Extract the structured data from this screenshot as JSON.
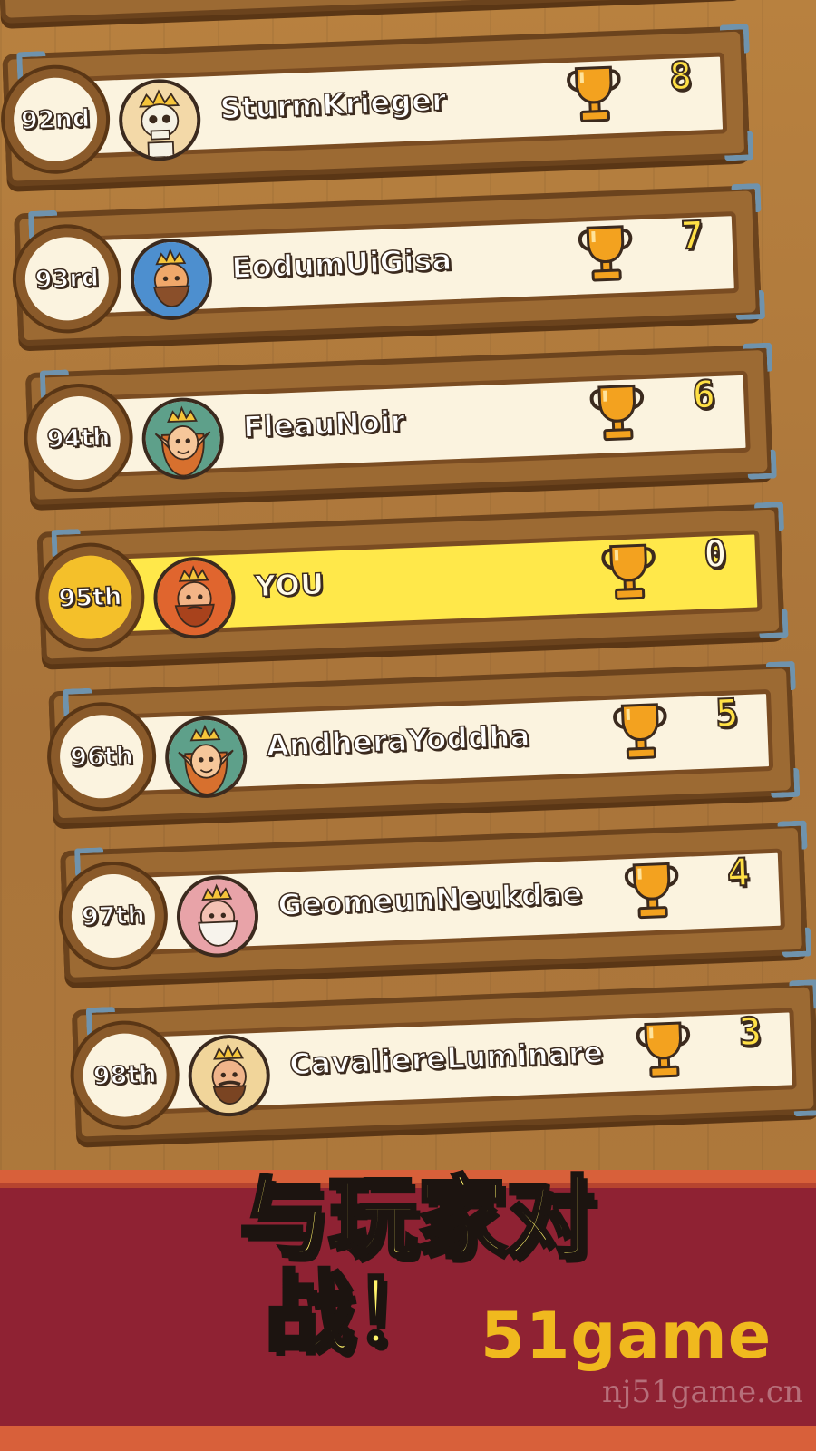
{
  "leaderboard": {
    "rows": [
      {
        "rank": "92nd",
        "name": "SturmKrieger",
        "score": "8",
        "avatar_icon": "skeleton-king-icon",
        "is_you": false
      },
      {
        "rank": "93rd",
        "name": "EodumUiGisa",
        "score": "7",
        "avatar_icon": "bearded-king-icon",
        "is_you": false
      },
      {
        "rank": "94th",
        "name": "FleauNoir",
        "score": "6",
        "avatar_icon": "elf-queen-icon",
        "is_you": false
      },
      {
        "rank": "95th",
        "name": "YOU",
        "score": "0",
        "avatar_icon": "red-beard-king-icon",
        "is_you": true
      },
      {
        "rank": "96th",
        "name": "AndheraYoddha",
        "score": "5",
        "avatar_icon": "elf-queen-icon",
        "is_you": false
      },
      {
        "rank": "97th",
        "name": "GeomeunNeukdae",
        "score": "4",
        "avatar_icon": "old-white-beard-king-icon",
        "is_you": false
      },
      {
        "rank": "98th",
        "name": "CavaliereLuminare",
        "score": "3",
        "avatar_icon": "mustache-king-icon",
        "is_you": false
      }
    ]
  },
  "banner": {
    "headline_line1": "与玩家对",
    "headline_line2": "战！"
  },
  "watermark": {
    "text": "51game",
    "sub": "nj51game.cn"
  },
  "colors": {
    "highlight": "#ffe84a",
    "score": "#ffe045",
    "banner": "#8f2233",
    "wood": "#9c6a33"
  }
}
